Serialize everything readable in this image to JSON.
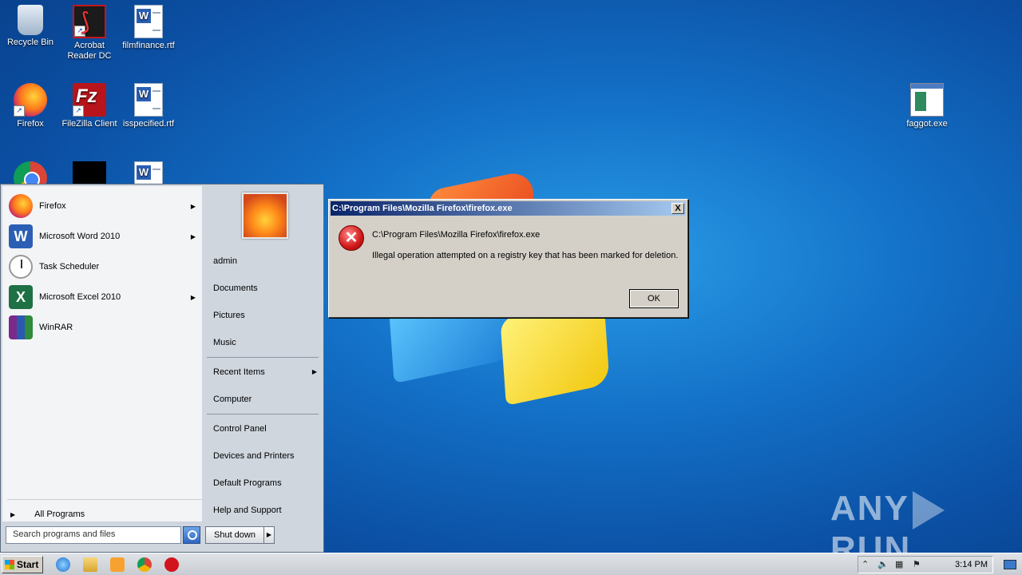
{
  "desktop": {
    "icons": [
      {
        "label": "Recycle Bin"
      },
      {
        "label": "Acrobat Reader DC"
      },
      {
        "label": "filmfinance.rtf"
      },
      {
        "label": "Firefox"
      },
      {
        "label": "FileZilla Client"
      },
      {
        "label": "isspecified.rtf"
      },
      {
        "label": "faggot.exe"
      }
    ]
  },
  "start_menu": {
    "pinned": [
      {
        "label": "Firefox",
        "has_submenu": true
      },
      {
        "label": "Microsoft Word 2010",
        "has_submenu": true
      },
      {
        "label": "Task Scheduler",
        "has_submenu": false
      },
      {
        "label": "Microsoft Excel 2010",
        "has_submenu": true
      },
      {
        "label": "WinRAR",
        "has_submenu": false
      }
    ],
    "all_programs": "All Programs",
    "search_placeholder": "Search programs and files",
    "right_links": [
      "admin",
      "Documents",
      "Pictures",
      "Music",
      "Recent Items",
      "Computer",
      "Control Panel",
      "Devices and Printers",
      "Default Programs",
      "Help and Support"
    ],
    "shutdown": "Shut down"
  },
  "dialog": {
    "title": "C:\\Program Files\\Mozilla Firefox\\firefox.exe",
    "close": "X",
    "message_path": "C:\\Program Files\\Mozilla Firefox\\firefox.exe",
    "message": "Illegal operation attempted on a registry key that has been marked for deletion.",
    "ok": "OK"
  },
  "watermark": {
    "left": "ANY",
    "right": "RUN"
  },
  "taskbar": {
    "start": "Start",
    "pinned": [
      "internet-explorer-icon",
      "windows-explorer-icon",
      "media-player-icon",
      "chrome-icon",
      "opera-icon"
    ],
    "clock": "3:14 PM"
  }
}
